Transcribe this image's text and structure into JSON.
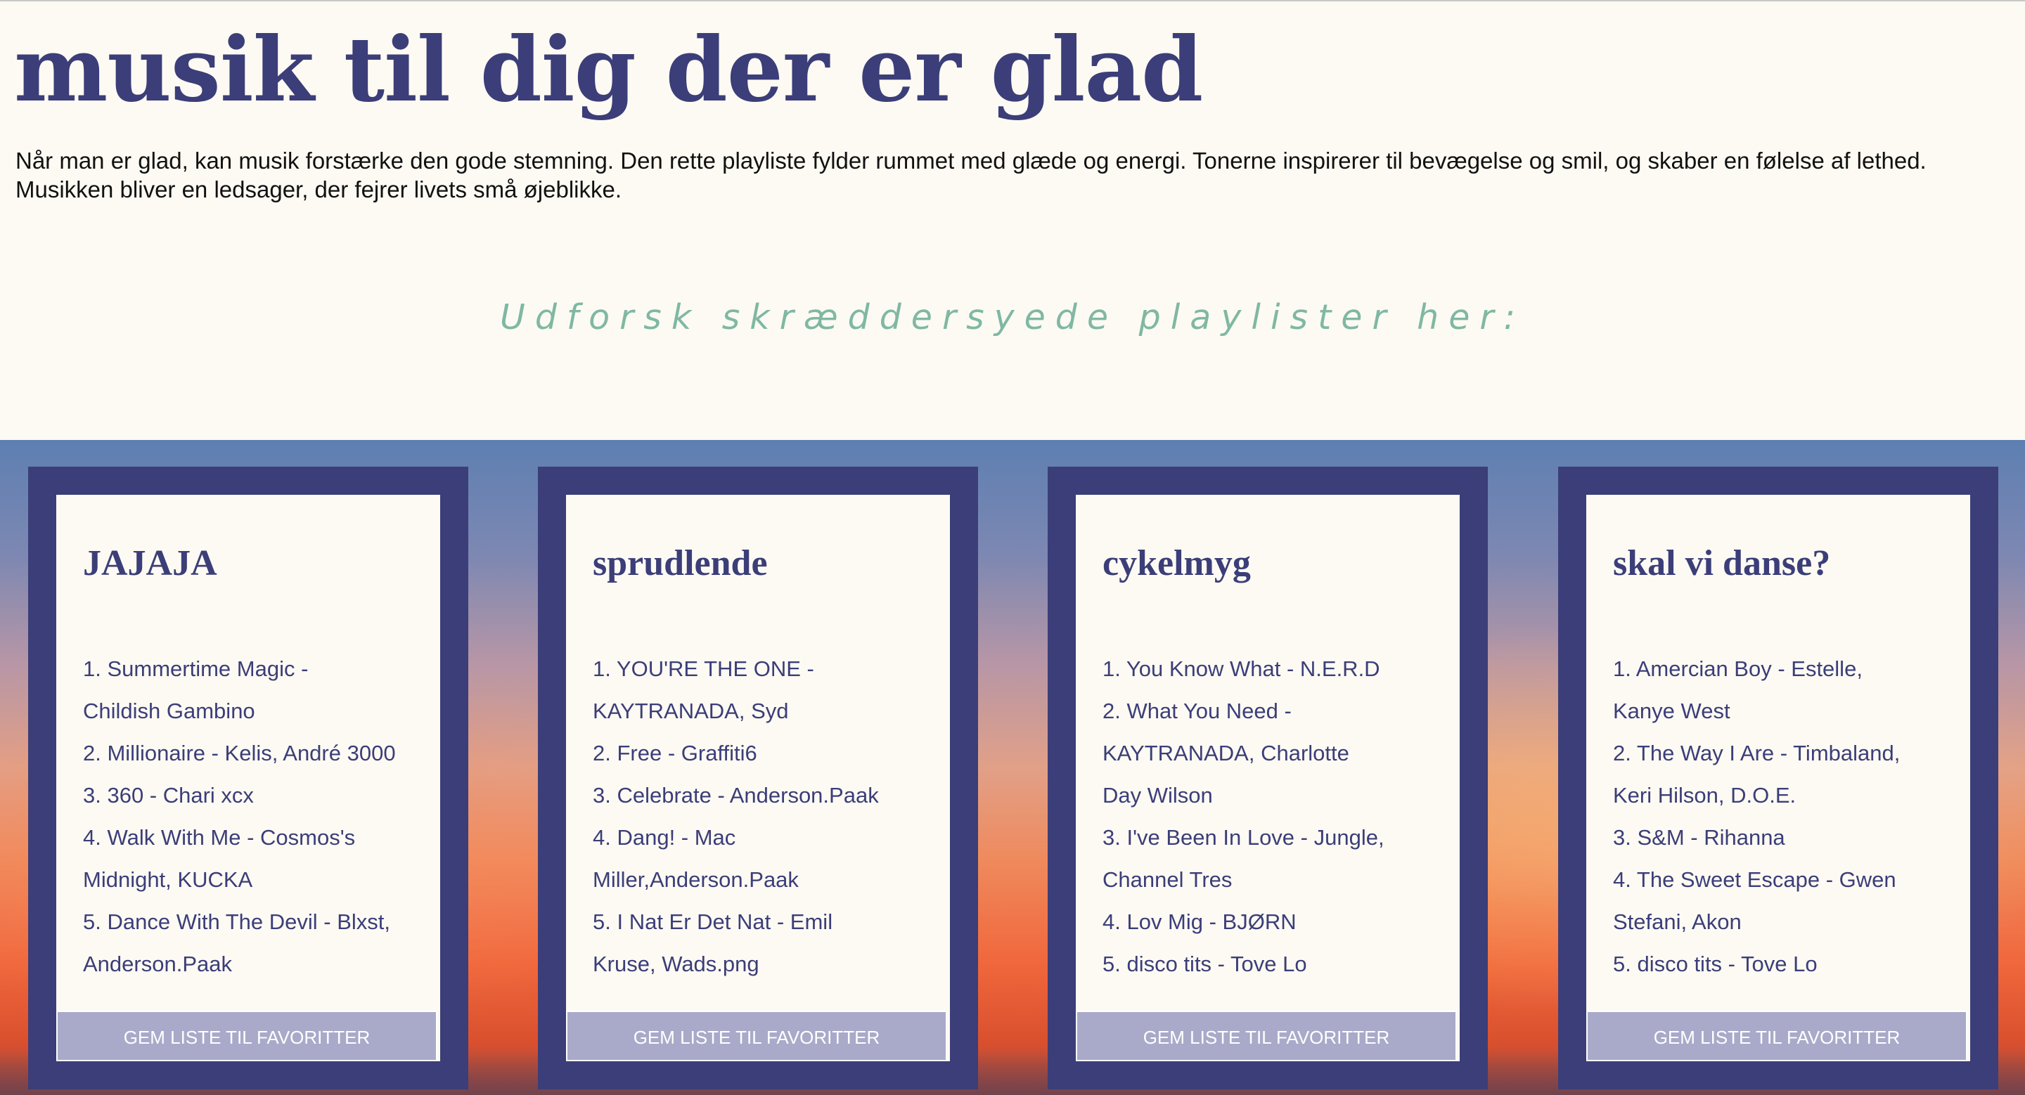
{
  "header": {
    "title": "musik til dig der er glad",
    "intro": "Når man er glad, kan musik forstærke den gode stemning. Den rette playliste fylder rummet med glæde og energi. Tonerne inspirerer til bevægelse og smil, og skaber en følelse af lethed. Musikken bliver en ledsager, der fejrer livets små øjeblikke.",
    "subtitle": "Udforsk skræddersyede playlister her:"
  },
  "colors": {
    "primary": "#3b3e78",
    "background": "#fdfaf3",
    "subtitle": "#7fb8a3",
    "button": "#a9aac9"
  },
  "playlists": [
    {
      "title": "JAJAJA",
      "tracks": [
        "1. Summertime Magic -",
        "Childish Gambino",
        "2. Millionaire - Kelis, André 3000",
        "3. 360 - Chari xcx",
        "4. Walk With Me - Cosmos's",
        "Midnight, KUCKA",
        "5. Dance With The Devil - Blxst,",
        "Anderson.Paak"
      ],
      "button": "GEM LISTE TIL FAVORITTER"
    },
    {
      "title": "sprudlende",
      "tracks": [
        "1. YOU'RE THE ONE -",
        "KAYTRANADA, Syd",
        "2. Free - Graffiti6",
        "3. Celebrate - Anderson.Paak",
        "4. Dang! - Mac",
        "Miller,Anderson.Paak",
        "5. I Nat Er Det Nat - Emil",
        "Kruse, Wads.png"
      ],
      "button": "GEM LISTE TIL FAVORITTER"
    },
    {
      "title": "cykelmyg",
      "tracks": [
        "1. You Know What - N.E.R.D",
        "2. What You Need -",
        "KAYTRANADA, Charlotte",
        "Day Wilson",
        "3. I've Been In Love - Jungle,",
        "Channel Tres",
        "4. Lov Mig - BJØRN",
        "5. disco tits - Tove Lo"
      ],
      "button": "GEM LISTE TIL FAVORITTER"
    },
    {
      "title": "skal vi danse?",
      "tracks": [
        "1. Amercian Boy - Estelle,",
        "Kanye West",
        "2. The Way I Are - Timbaland,",
        "Keri Hilson, D.O.E.",
        "3. S&M - Rihanna",
        "4. The Sweet Escape - Gwen",
        "Stefani, Akon",
        "5. disco tits - Tove Lo"
      ],
      "button": "GEM LISTE TIL FAVORITTER"
    }
  ]
}
